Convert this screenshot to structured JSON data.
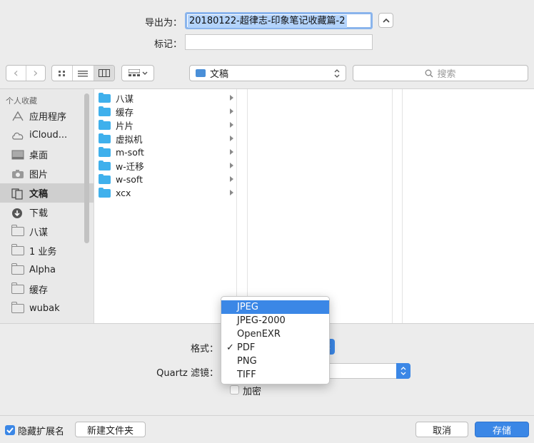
{
  "export": {
    "filename_label": "导出为：",
    "filename_value": "20180122-超律志-印象笔记收藏篇-2",
    "tags_label": "标记：",
    "tags_value": ""
  },
  "toolbar": {
    "back_glyph": "‹",
    "forward_glyph": "›",
    "location": "文稿",
    "search_placeholder": "搜索"
  },
  "sidebar": {
    "heading": "个人收藏",
    "items": [
      {
        "label": "应用程序",
        "icon": "applications-icon"
      },
      {
        "label": "iCloud...",
        "icon": "cloud-icon"
      },
      {
        "label": "桌面",
        "icon": "desktop-icon"
      },
      {
        "label": "图片",
        "icon": "camera-icon"
      },
      {
        "label": "文稿",
        "icon": "documents-icon",
        "selected": true
      },
      {
        "label": "下载",
        "icon": "download-icon"
      },
      {
        "label": "八谋",
        "icon": "folder-icon"
      },
      {
        "label": "1 业务",
        "icon": "folder-icon"
      },
      {
        "label": "Alpha",
        "icon": "folder-icon"
      },
      {
        "label": "缓存",
        "icon": "folder-icon"
      },
      {
        "label": "wubak",
        "icon": "folder-icon"
      }
    ]
  },
  "files": [
    {
      "label": "八谋"
    },
    {
      "label": "缓存"
    },
    {
      "label": "片片"
    },
    {
      "label": "虚拟机"
    },
    {
      "label": "m-soft"
    },
    {
      "label": "w-迁移"
    },
    {
      "label": "w-soft"
    },
    {
      "label": "xcx"
    }
  ],
  "format": {
    "label": "格式：",
    "filter_label": "Quartz 滤镜：",
    "options": [
      "JPEG",
      "JPEG-2000",
      "OpenEXR",
      "PDF",
      "PNG",
      "TIFF"
    ],
    "highlighted": "JPEG",
    "checked": "PDF",
    "check_glyph": "✓",
    "encrypt_label": "加密"
  },
  "footer": {
    "hide_ext_label": "隐藏扩展名",
    "new_folder_label": "新建文件夹",
    "cancel_label": "取消",
    "save_label": "存储"
  },
  "colors": {
    "accent": "#3b87e6",
    "folder": "#3fb0ec"
  }
}
